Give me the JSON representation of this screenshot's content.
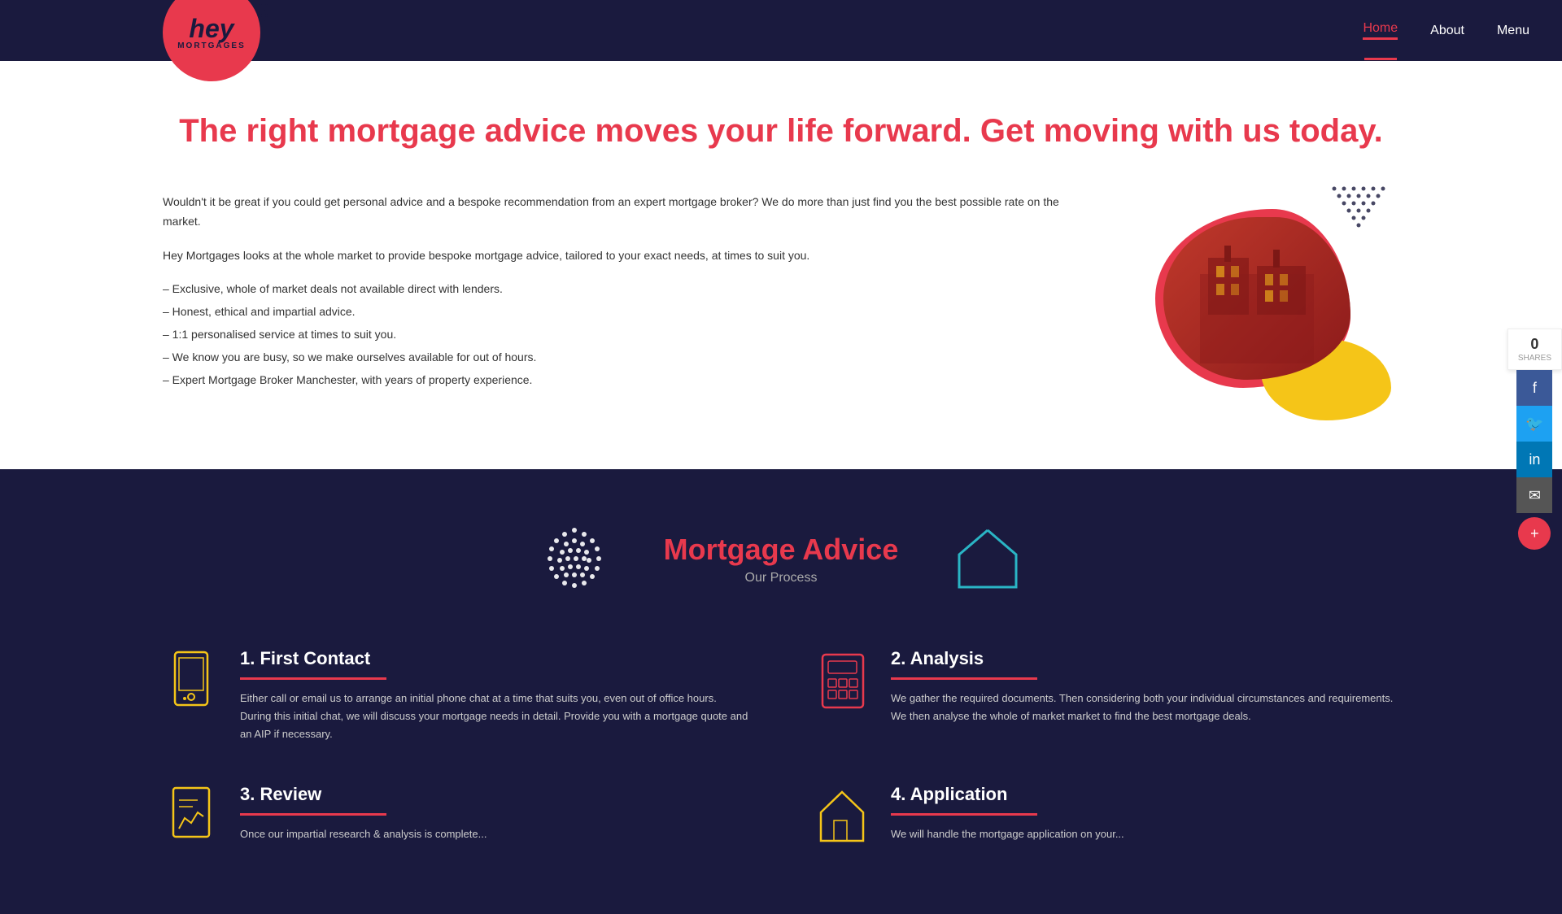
{
  "header": {
    "logo_hey": "hey",
    "logo_mortgages": "MORTGAGES",
    "nav": {
      "home_label": "Home",
      "about_label": "About",
      "menu_label": "Menu"
    }
  },
  "hero": {
    "title": "The right mortgage advice moves your life forward. Get moving with us today.",
    "paragraph1": "Wouldn't it be great if you could get personal advice and a bespoke recommendation from an expert mortgage broker? We do more than just find you the best possible rate on the market.",
    "paragraph2": "Hey Mortgages looks at the whole market to provide bespoke mortgage advice, tailored to your exact needs, at times to suit you.",
    "bullet1": "– Exclusive, whole of market deals not available direct with lenders.",
    "bullet2": "– Honest, ethical and impartial advice.",
    "bullet3": "– 1:1 personalised service at times to suit you.",
    "bullet4": "– We know you are busy, so we make ourselves available for out of hours.",
    "bullet5": "– Expert Mortgage Broker Manchester, with years of property experience."
  },
  "process": {
    "title": "Mortgage Advice",
    "subtitle": "Our Process",
    "steps": [
      {
        "number": "1.",
        "title": "First Contact",
        "description": "Either call or email us to arrange an initial phone chat at a time that suits you, even out of office hours. During this initial chat, we will discuss your mortgage needs in detail. Provide you with a mortgage quote and an AIP if necessary."
      },
      {
        "number": "2.",
        "title": "Analysis",
        "description": "We gather the required documents. Then considering both your individual circumstances and requirements. We then analyse the whole of market market to find the best mortgage deals."
      },
      {
        "number": "3.",
        "title": "Review",
        "description": "Once our impartial research & analysis is complete..."
      },
      {
        "number": "4.",
        "title": "Application",
        "description": "We will handle the mortgage application on your..."
      }
    ]
  },
  "social": {
    "shares_count": "0",
    "shares_label": "SHARES"
  },
  "colors": {
    "brand_red": "#e8394d",
    "brand_dark": "#1a1a3e",
    "brand_yellow": "#f5c518",
    "teal": "#2ab5c5"
  }
}
